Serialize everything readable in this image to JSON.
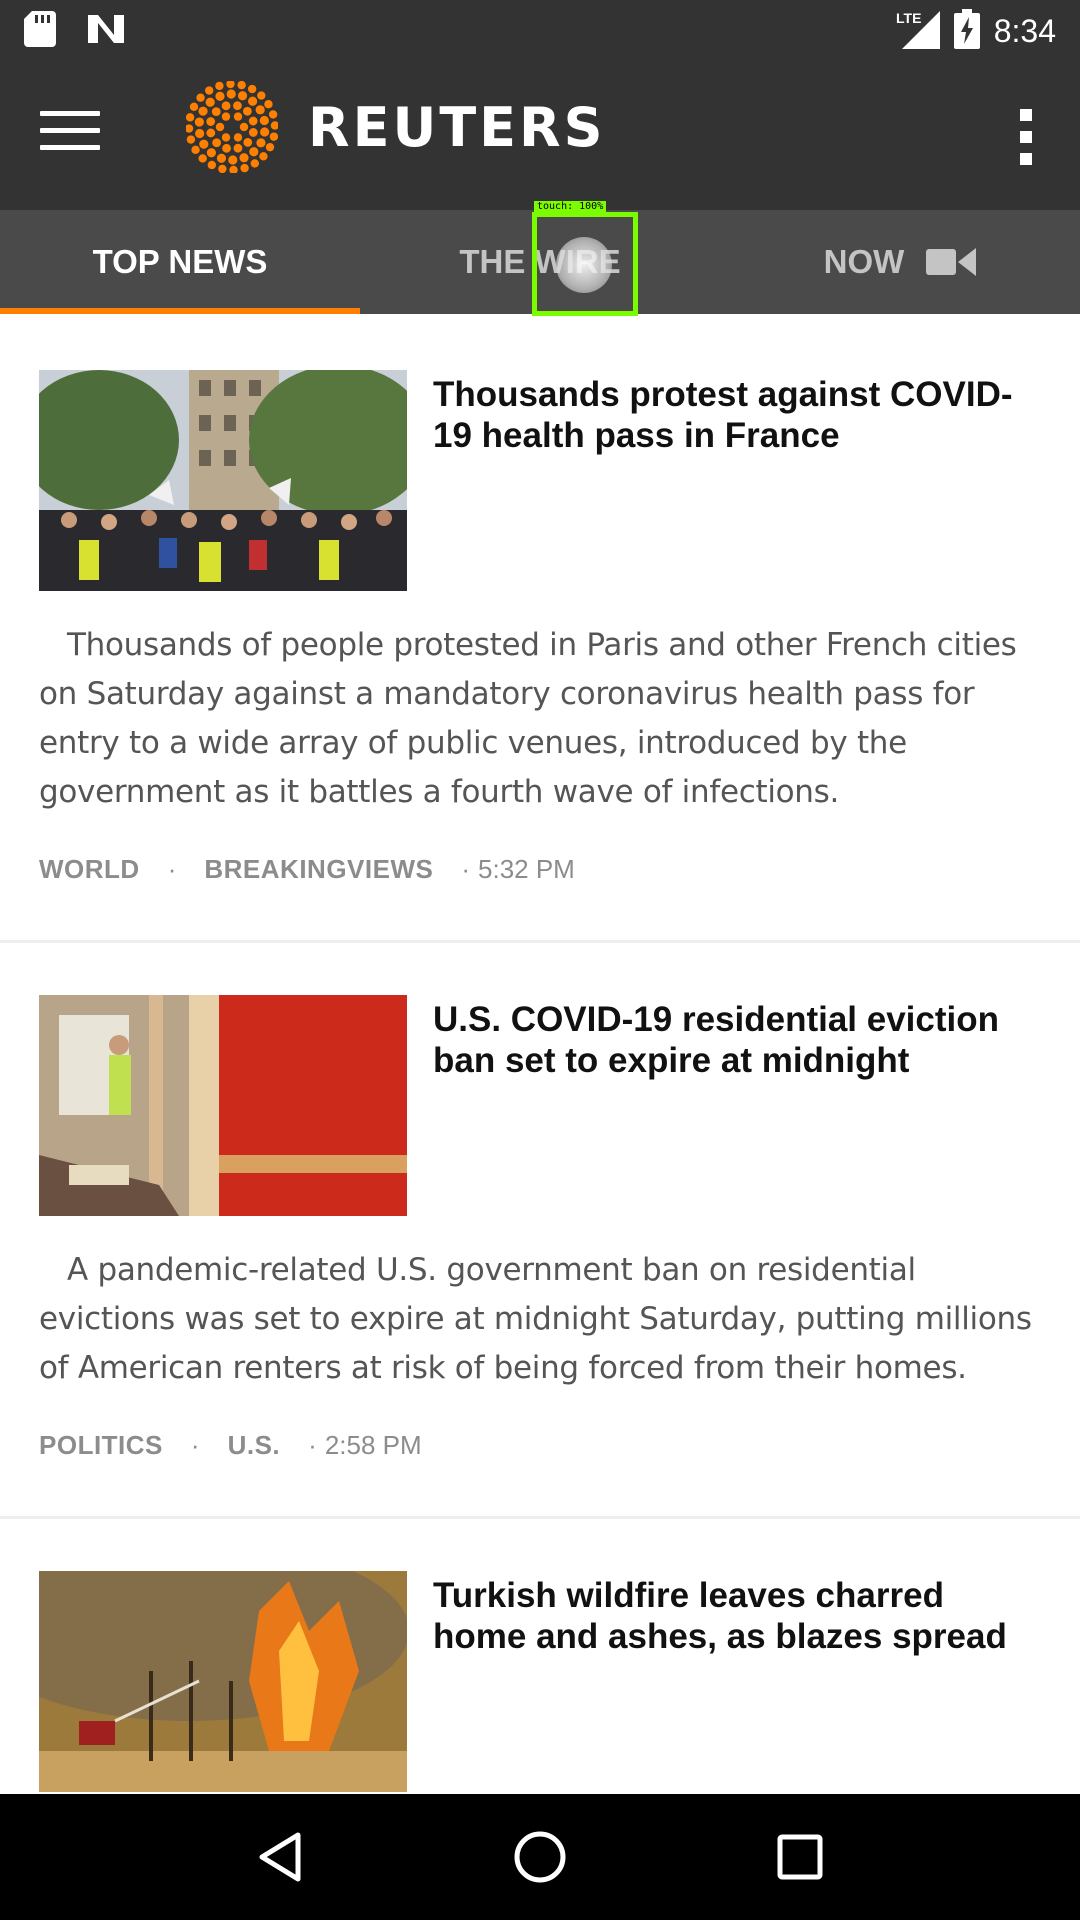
{
  "status_bar": {
    "time": "8:34",
    "network": "LTE",
    "icons": [
      "sd-card-icon",
      "n-notification-icon",
      "signal-icon",
      "battery-charging-icon"
    ]
  },
  "app_bar": {
    "logo_text": "REUTERS",
    "brand_color": "#ff8000",
    "menu_icon": "hamburger-menu-icon",
    "overflow_icon": "more-vert-icon"
  },
  "tabs": [
    {
      "label": "TOP NEWS",
      "active": true
    },
    {
      "label": "THE WIRE",
      "active": false
    },
    {
      "label": "NOW",
      "active": false,
      "icon": "video-camera-icon"
    }
  ],
  "touch_indicator": {
    "label": "touch: 100%"
  },
  "articles": [
    {
      "headline": "Thousands protest against COVID-19 health pass in France",
      "summary": "Thousands of people protested in Paris and other French cities on Saturday against a mandatory coronavirus health pass for entry to a wide array of public venues, introduced by the government as it battles a fourth wave of infections.",
      "categories": [
        "WORLD",
        "BREAKINGVIEWS"
      ],
      "time": "5:32 PM",
      "image": "protest-crowd-photo"
    },
    {
      "headline": "U.S. COVID-19 residential eviction ban set to expire at midnight",
      "summary": "A pandemic-related U.S. government ban on residential evictions was set to expire at midnight Saturday, putting millions of American renters at risk of being forced from their homes.",
      "categories": [
        "POLITICS",
        "U.S."
      ],
      "time": "2:58 PM",
      "image": "eviction-room-photo"
    },
    {
      "headline": "Turkish wildfire leaves charred home and ashes, as blazes spread",
      "image": "wildfire-photo"
    }
  ],
  "nav_bar": {
    "back": "back-triangle-icon",
    "home": "home-circle-icon",
    "recents": "recents-square-icon"
  }
}
